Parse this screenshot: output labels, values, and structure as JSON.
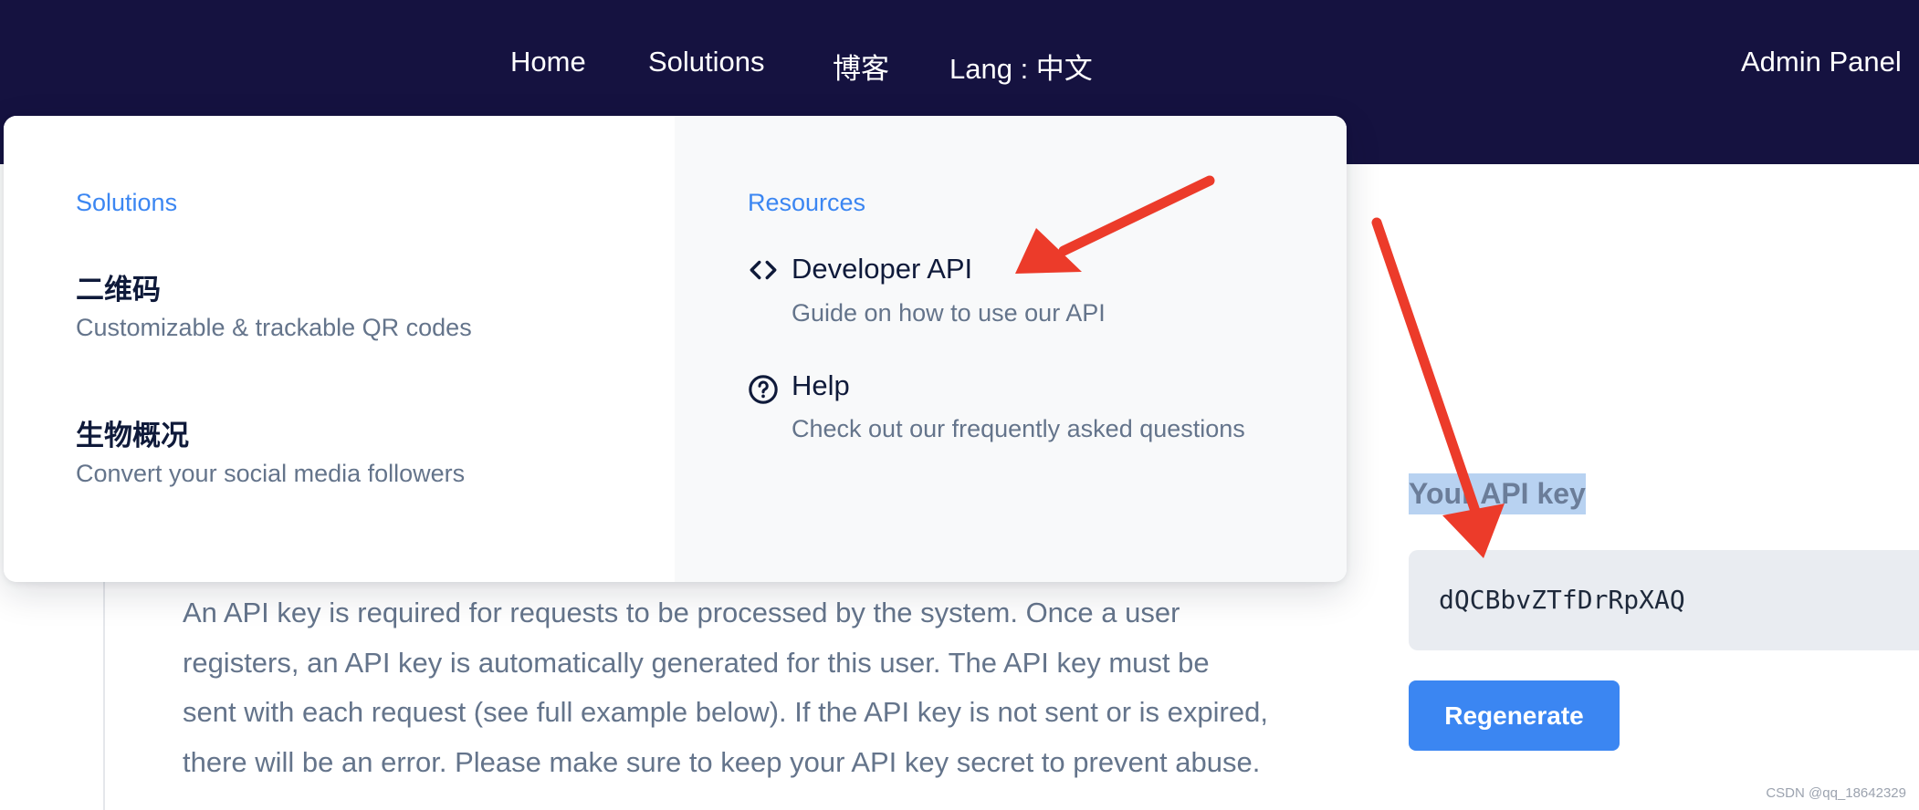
{
  "nav": {
    "home": "Home",
    "solutions": "Solutions",
    "blog": "博客",
    "lang": "Lang : 中文",
    "admin": "Admin Panel"
  },
  "dropdown": {
    "solutions": {
      "title": "Solutions",
      "items": [
        {
          "title": "二维码",
          "desc": "Customizable & trackable QR codes"
        },
        {
          "title": "生物概况",
          "desc": "Convert your social media followers"
        }
      ]
    },
    "resources": {
      "title": "Resources",
      "items": [
        {
          "title": "Developer API",
          "desc": "Guide on how to use our API",
          "icon": "code-icon"
        },
        {
          "title": "Help",
          "desc": "Check out our frequently asked questions",
          "icon": "question-circle-icon"
        }
      ]
    }
  },
  "content": {
    "paragraph": "An API key is required for requests to be processed by the system. Once a user registers, an API key is automatically generated for this user. The API key must be sent with each request (see full example below). If the API key is not sent or is expired, there will be an error. Please make sure to keep your API key secret to prevent abuse."
  },
  "api_key": {
    "heading": "Your API key",
    "value": "dQCBbvZTfDrRpXAQ",
    "regenerate": "Regenerate"
  },
  "colors": {
    "nav_bg": "#151240",
    "accent": "#3b86f2",
    "annotation": "#ec3b2a"
  },
  "watermark": "CSDN @qq_18642329"
}
